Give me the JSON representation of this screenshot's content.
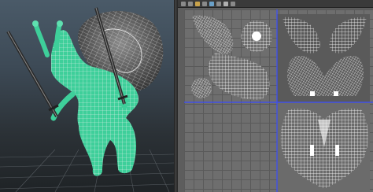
{
  "viewport": {
    "name": "perspective-viewport",
    "background_top": "#4a5a68",
    "background_bottom": "#1f2326",
    "model_color": "#3ecf9a",
    "wire_color": "#e8e8e8"
  },
  "uv_editor": {
    "name": "uv-texture-editor",
    "toolbar_icons": [
      "grid-icon",
      "snap-icon",
      "image-icon",
      "checker-icon",
      "shade-icon",
      "isolate-icon",
      "frame-icon",
      "uv-layout-icon"
    ],
    "axis_u_color": "#3a4cff",
    "axis_v_color": "#3a4cff",
    "shell_color": "#f2f2f2"
  }
}
